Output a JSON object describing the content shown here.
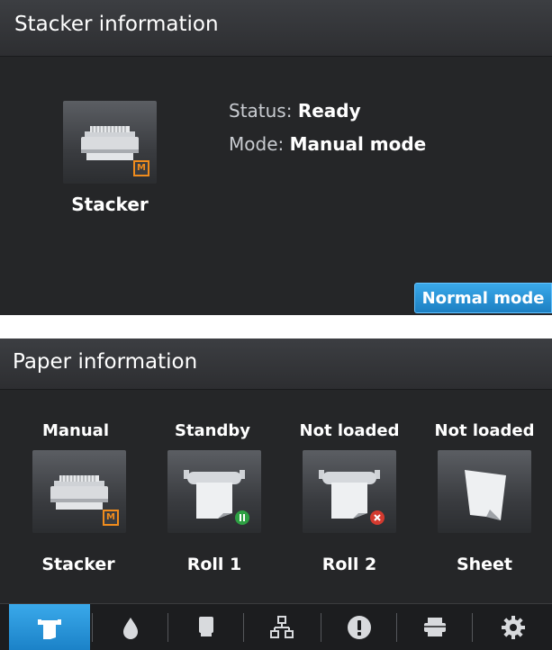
{
  "stacker_panel": {
    "title": "Stacker information",
    "tile_caption": "Stacker",
    "status_key": "Status:",
    "status_value": "Ready",
    "mode_key": "Mode:",
    "mode_value": "Manual mode",
    "normal_mode_button": "Normal mode",
    "badge": "M"
  },
  "paper_panel": {
    "title": "Paper information",
    "items": [
      {
        "state": "Manual",
        "label": "Stacker",
        "badge": "M"
      },
      {
        "state": "Standby",
        "label": "Roll 1",
        "badge": "pause"
      },
      {
        "state": "Not loaded",
        "label": "Roll 2",
        "badge": "error"
      },
      {
        "state": "Not loaded",
        "label": "Sheet"
      }
    ]
  },
  "toolbar": {
    "items": [
      "paper-icon",
      "ink-drop-icon",
      "printhead-icon",
      "network-icon",
      "alert-icon",
      "printer-icon",
      "settings-gear-icon"
    ],
    "active_index": 0
  },
  "colors": {
    "accent_blue": "#2a95db",
    "warning_orange": "#f08c1d",
    "status_green": "#2ea043",
    "error_red": "#d43a2f"
  }
}
